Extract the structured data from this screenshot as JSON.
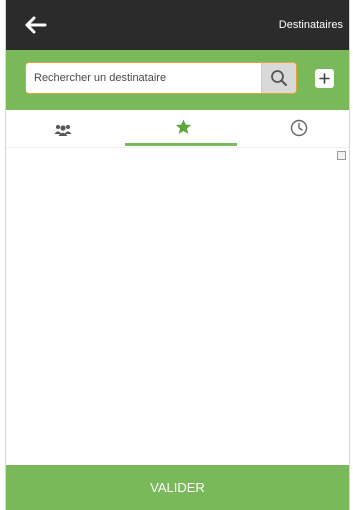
{
  "header": {
    "title": "Destinataires",
    "back_icon": "arrow-left-icon"
  },
  "search": {
    "placeholder": "Rechercher un destinataire",
    "value": "",
    "search_icon": "magnifier-icon",
    "add_icon": "plus-icon"
  },
  "tabs": [
    {
      "name": "groups",
      "icon": "users-icon",
      "selected": false
    },
    {
      "name": "favorites",
      "icon": "star-icon",
      "selected": true
    },
    {
      "name": "recent",
      "icon": "clock-icon",
      "selected": false
    }
  ],
  "list": {
    "items": [],
    "select_all_checked": false
  },
  "footer": {
    "validate_label": "VALIDER"
  },
  "colors": {
    "header_bg": "#2b2b2b",
    "accent_green": "#7ab95a",
    "search_border": "#e0a43a",
    "icon_gray": "#666666"
  }
}
